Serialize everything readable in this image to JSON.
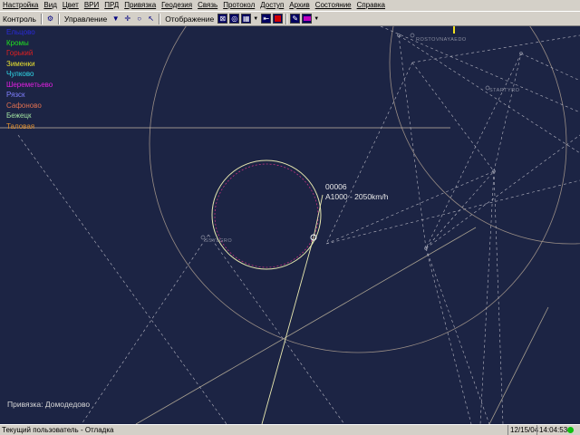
{
  "menu": [
    "Настройка",
    "Вид",
    "Цвет",
    "ВРИ",
    "ПРД",
    "Привязка",
    "Геодезия",
    "Связь",
    "Протокол",
    "Доступ",
    "Архив",
    "Состояние",
    "Справка"
  ],
  "toolbar": {
    "control_label": "Контроль",
    "management_label": "Управление",
    "display_label": "Отображение"
  },
  "legend": [
    {
      "label": "Ельцово",
      "color": "#2a2ad8"
    },
    {
      "label": "Кромы",
      "color": "#20e020"
    },
    {
      "label": "Горький",
      "color": "#e02020"
    },
    {
      "label": "Зименки",
      "color": "#e8e030"
    },
    {
      "label": "Чулково",
      "color": "#30d8e8"
    },
    {
      "label": "Шереметьево",
      "color": "#e020e0"
    },
    {
      "label": "Рязск",
      "color": "#8080ff"
    },
    {
      "label": "Сафоново",
      "color": "#e07050"
    },
    {
      "label": "Бежецк",
      "color": "#a0e0a0"
    },
    {
      "label": "Таловая",
      "color": "#e09030"
    }
  ],
  "map": {
    "binding_text": "Привязка: Домодедово",
    "target": {
      "id": "00006",
      "info": "A1000 - 2050km/h"
    },
    "waypoints": [
      {
        "label": "ROSTOVNAYAEDO"
      },
      {
        "label": "STARTYRO"
      },
      {
        "label": "SSYLGRO"
      }
    ]
  },
  "status": {
    "user_text": "Текущий пользователь - Отладка",
    "date": "12/15/04",
    "time": "14:04:53"
  }
}
